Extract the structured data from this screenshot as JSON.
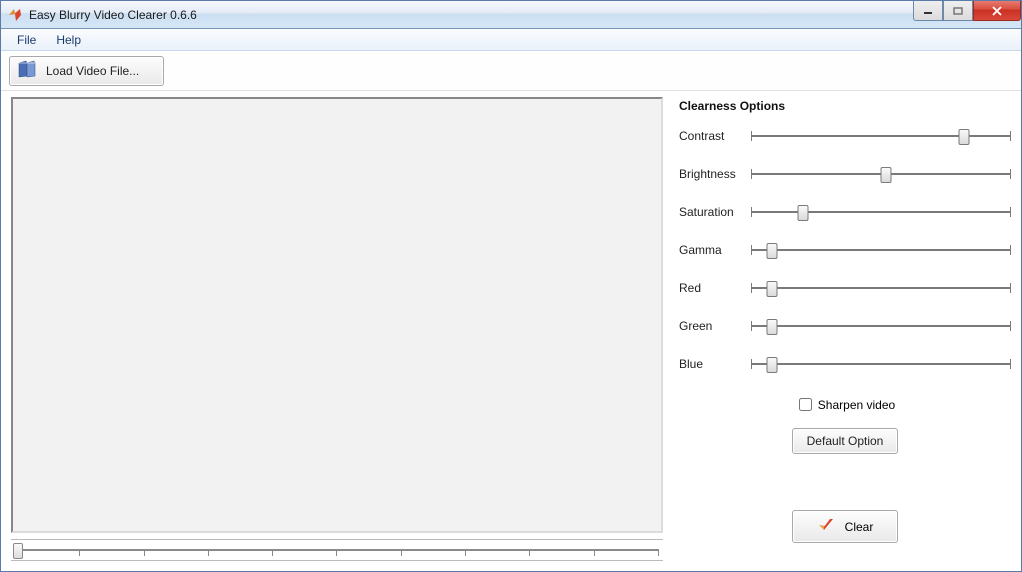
{
  "window": {
    "title": "Easy Blurry Video Clearer 0.6.6"
  },
  "menu": {
    "file": "File",
    "help": "Help"
  },
  "toolbar": {
    "load_label": "Load Video File..."
  },
  "options": {
    "title": "Clearness Options",
    "sliders": [
      {
        "label": "Contrast",
        "pos": 82
      },
      {
        "label": "Brightness",
        "pos": 52
      },
      {
        "label": "Saturation",
        "pos": 20
      },
      {
        "label": "Gamma",
        "pos": 8
      },
      {
        "label": "Red",
        "pos": 8
      },
      {
        "label": "Green",
        "pos": 8
      },
      {
        "label": "Blue",
        "pos": 8
      }
    ],
    "sharpen_label": "Sharpen video",
    "sharpen_checked": false,
    "default_btn": "Default Option",
    "clear_btn": "Clear"
  },
  "timeline": {
    "pos": 0
  }
}
